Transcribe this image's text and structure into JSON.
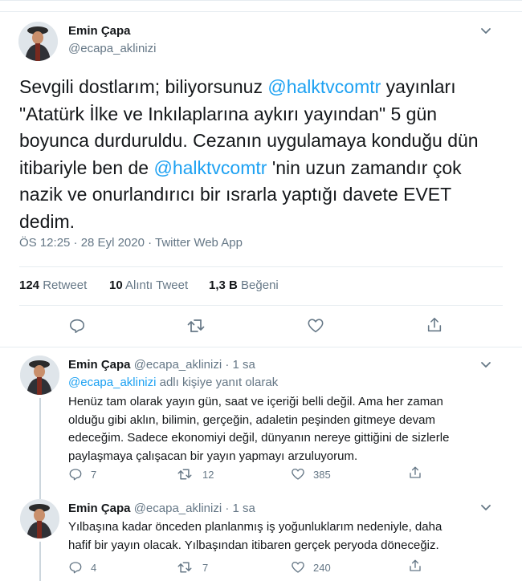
{
  "main": {
    "author_name": "Emin Çapa",
    "author_handle": "@ecapa_aklinizi",
    "text_parts": [
      "Sevgili dostlarım; biliyorsunuz ",
      "@halktvcomtr",
      " yayınları \"Atatürk İlke ve Inkılaplarına aykırı yayından\" 5 gün boyunca durduruldu. Cezanın uygulamaya konduğu dün itibariyle ben de ",
      "@halktvcomtr",
      " 'nin uzun zamandır çok nazik ve onurlandırıcı bir ısrarla yaptığı davete EVET dedim."
    ],
    "meta": "ÖS 12:25 · 28 Eyl 2020 · Twitter Web App",
    "stats": {
      "retweets_num": "124",
      "retweets_label": "Retweet",
      "quotes_num": "10",
      "quotes_label": "Alıntı Tweet",
      "likes_num": "1,3 B",
      "likes_label": "Beğeni"
    }
  },
  "replies": [
    {
      "author_name": "Emin Çapa",
      "author_handle": "@ecapa_aklinizi",
      "time": "· 1 sa",
      "reply_to_handle": "@ecapa_aklinizi",
      "reply_to_suffix": " adlı kişiye yanıt olarak",
      "text": "Henüz tam olarak yayın gün, saat ve içeriği belli değil. Ama her zaman olduğu gibi aklın, bilimin, gerçeğin, adaletin peşinden gitmeye devam edeceğim. Sadece ekonomiyi değil, dünyanın nereye gittiğini de sizlerle paylaşmaya çalışacan bir yayın yapmayı arzuluyorum.",
      "replies_count": "7",
      "retweets_count": "12",
      "likes_count": "385"
    },
    {
      "author_name": "Emin Çapa",
      "author_handle": "@ecapa_aklinizi",
      "time": "· 1 sa",
      "text": "Yılbaşına kadar önceden planlanmış iş yoğunluklarım nedeniyle, daha hafif bir yayın olacak. Yılbaşından itibaren gerçek peryoda döneceğiz.",
      "replies_count": "4",
      "retweets_count": "7",
      "likes_count": "240"
    }
  ],
  "icons": {
    "reply": "reply-icon",
    "retweet": "retweet-icon",
    "like": "heart-icon",
    "share": "share-icon",
    "caret": "chevron-down-icon"
  },
  "colors": {
    "accent": "#1da1f2",
    "muted": "#657786",
    "border": "#e6ecf0"
  }
}
